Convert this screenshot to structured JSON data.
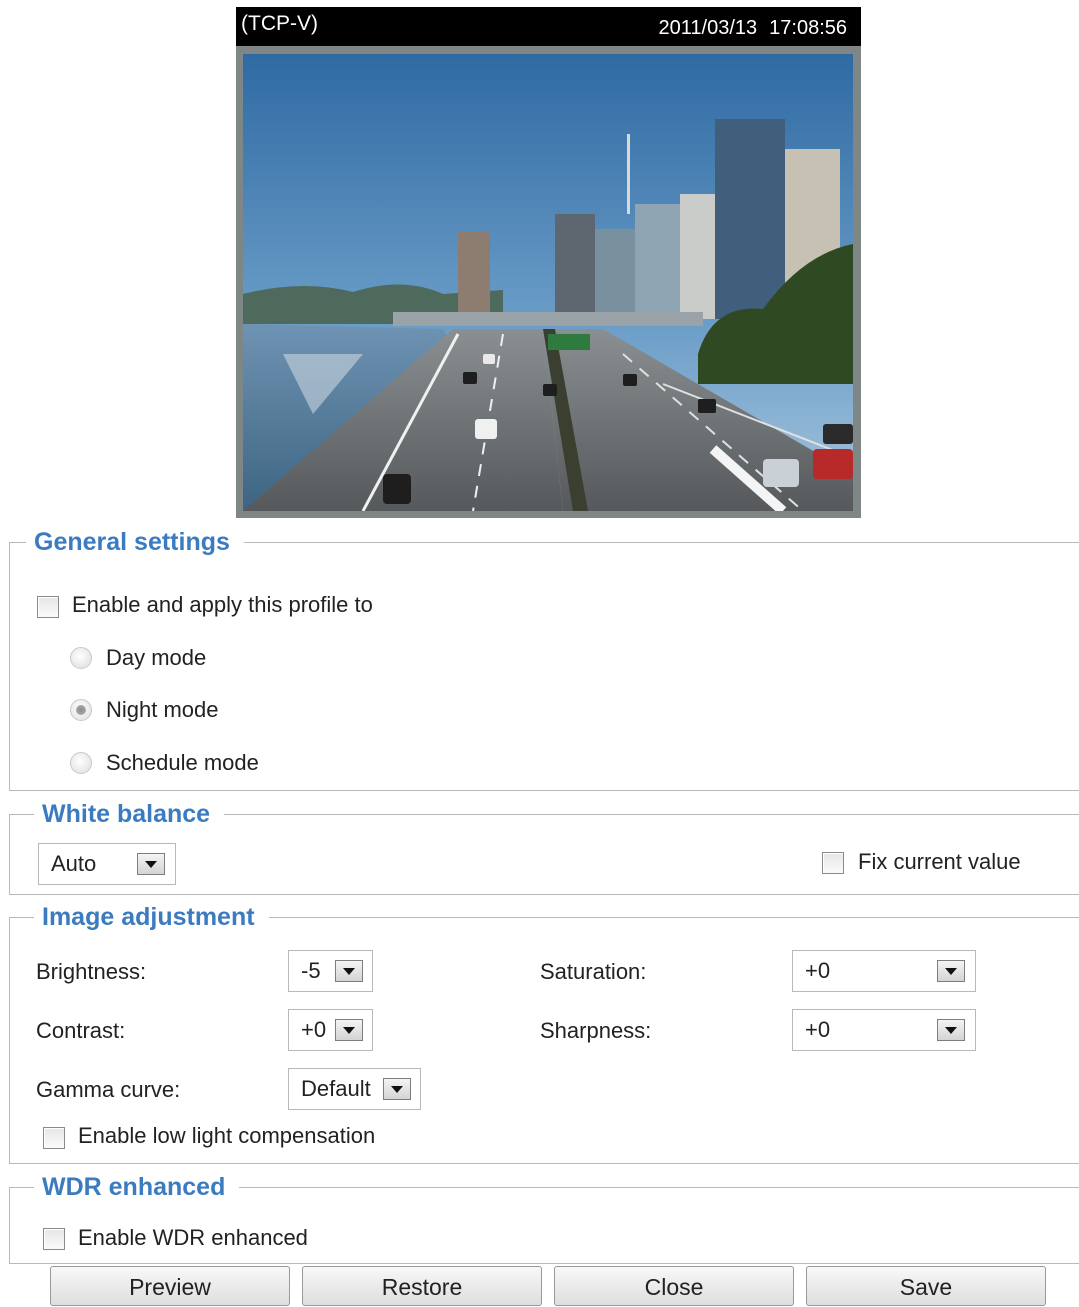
{
  "viewer": {
    "stream_label": "(TCP-V)",
    "date": "2011/03/13",
    "time": "17:08:56"
  },
  "general": {
    "legend": "General settings",
    "enable_label": "Enable and apply this profile to",
    "enable_checked": false,
    "modes": [
      {
        "label": "Day mode",
        "checked": false
      },
      {
        "label": "Night mode",
        "checked": true
      },
      {
        "label": "Schedule mode",
        "checked": false
      }
    ]
  },
  "white_balance": {
    "legend": "White balance",
    "value": "Auto",
    "fix_label": "Fix current value",
    "fix_checked": false
  },
  "image_adjustment": {
    "legend": "Image adjustment",
    "brightness_label": "Brightness:",
    "brightness_value": "-5",
    "saturation_label": "Saturation:",
    "saturation_value": "+0",
    "contrast_label": "Contrast:",
    "contrast_value": "+0",
    "sharpness_label": "Sharpness:",
    "sharpness_value": "+0",
    "gamma_label": "Gamma curve:",
    "gamma_value": "Default",
    "low_light_label": "Enable low light compensation",
    "low_light_checked": false
  },
  "wdr": {
    "legend": "WDR enhanced",
    "enable_label": "Enable WDR enhanced",
    "enable_checked": false
  },
  "buttons": {
    "preview": "Preview",
    "restore": "Restore",
    "close": "Close",
    "save": "Save"
  },
  "colors": {
    "legend_blue": "#3b7bc0",
    "viewer_bar": "#000000",
    "viewer_frame": "#7f8786"
  }
}
